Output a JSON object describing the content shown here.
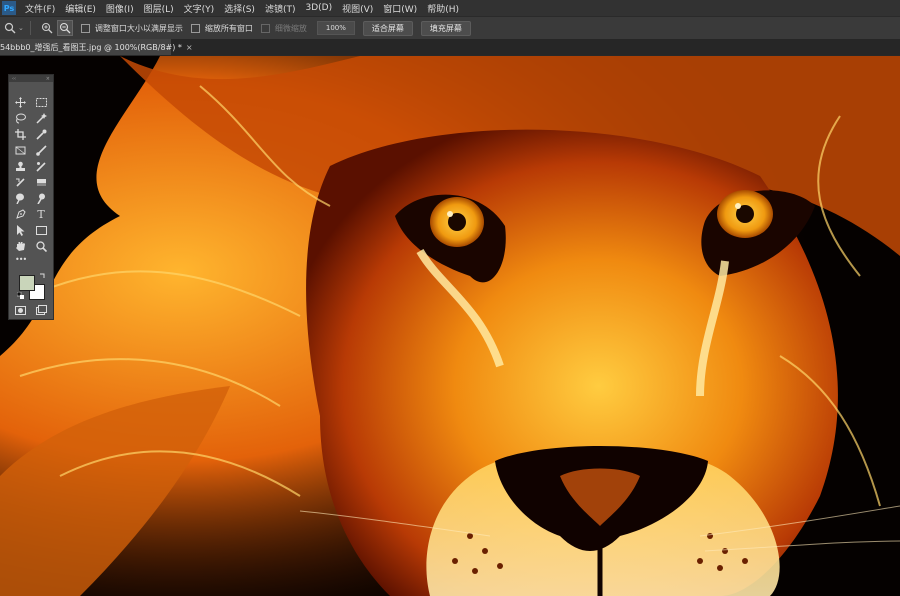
{
  "app": {
    "logo_text": "Ps"
  },
  "menu": [
    "文件(F)",
    "编辑(E)",
    "图像(I)",
    "图层(L)",
    "文字(Y)",
    "选择(S)",
    "滤镜(T)",
    "3D(D)",
    "视图(V)",
    "窗口(W)",
    "帮助(H)"
  ],
  "options_bar": {
    "zoom_in_icon": "zoom-in-icon",
    "zoom_out_icon": "zoom-out-icon",
    "resize_windows_label": "调整窗口大小以满屏显示",
    "zoom_all_windows_label": "缩放所有窗口",
    "scrubby_zoom_label": "细微缩放",
    "zoom_value": "100%",
    "fit_screen_label": "适合屏幕",
    "fill_screen_label": "填充屏幕"
  },
  "document_tab": {
    "title": "54bbb0_增强后_看图王.jpg @ 100%(RGB/8#) *",
    "close": "×"
  },
  "toolbox": {
    "collapse": "‹‹",
    "close": "×",
    "tools": [
      "move-tool-icon",
      "marquee-tool-icon",
      "lasso-tool-icon",
      "magic-wand-icon",
      "crop-tool-icon",
      "eyedropper-icon",
      "frame-tool-icon",
      "brush-tool-icon",
      "stamp-tool-icon",
      "healing-brush-icon",
      "history-brush-icon",
      "eraser-icon",
      "dodge-tool-icon",
      "smudge-tool-icon",
      "pen-tool-icon",
      "type-tool-icon",
      "path-select-icon",
      "rectangle-tool-icon",
      "hand-tool-icon",
      "zoom-tool-icon"
    ],
    "type_glyph": "T",
    "more": "•••",
    "foreground_color": "#c9d5ba",
    "background_color": "#ffffff"
  },
  "canvas": {
    "image": "fire-lion-artwork"
  }
}
